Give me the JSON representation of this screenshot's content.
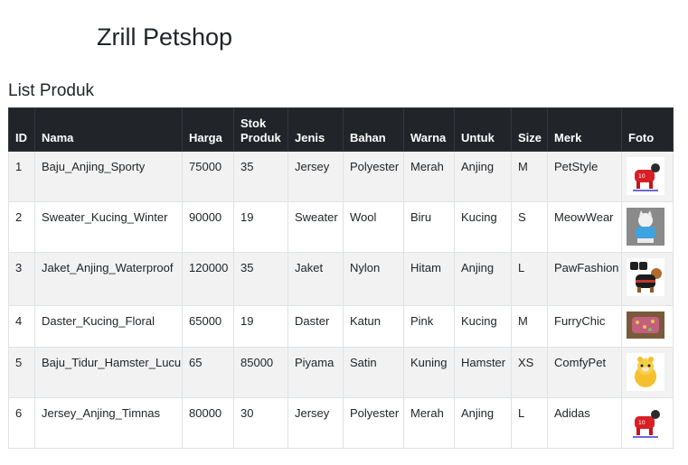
{
  "header": {
    "title": "Zrill Petshop"
  },
  "section": {
    "title": "List Produk"
  },
  "table": {
    "columns": [
      "ID",
      "Nama",
      "Harga",
      "Stok Produk",
      "Jenis",
      "Bahan",
      "Warna",
      "Untuk",
      "Size",
      "Merk",
      "Foto"
    ],
    "rows": [
      {
        "id": "1",
        "nama": "Baju_Anjing_Sporty",
        "harga": "75000",
        "stok": "35",
        "jenis": "Jersey",
        "bahan": "Polyester",
        "warna": "Merah",
        "untuk": "Anjing",
        "size": "M",
        "merk": "PetStyle",
        "foto": "red-dog-jersey-photo"
      },
      {
        "id": "2",
        "nama": "Sweater_Kucing_Winter",
        "harga": "90000",
        "stok": "19",
        "jenis": "Sweater",
        "bahan": "Wool",
        "warna": "Biru",
        "untuk": "Kucing",
        "size": "S",
        "merk": "MeowWear",
        "foto": "cat-blue-sweater-photo"
      },
      {
        "id": "3",
        "nama": "Jaket_Anjing_Waterproof",
        "harga": "120000",
        "stok": "35",
        "jenis": "Jaket",
        "bahan": "Nylon",
        "warna": "Hitam",
        "untuk": "Anjing",
        "size": "L",
        "merk": "PawFashion",
        "foto": "dog-black-jacket-photo"
      },
      {
        "id": "4",
        "nama": "Daster_Kucing_Floral",
        "harga": "65000",
        "stok": "19",
        "jenis": "Daster",
        "bahan": "Katun",
        "warna": "Pink",
        "untuk": "Kucing",
        "size": "M",
        "merk": "FurryChic",
        "foto": "floral-cat-dress-photo"
      },
      {
        "id": "5",
        "nama": "Baju_Tidur_Hamster_Lucu",
        "harga": "65",
        "stok": "85000",
        "jenis": "Piyama",
        "bahan": "Satin",
        "warna": "Kuning",
        "untuk": "Hamster",
        "size": "XS",
        "merk": "ComfyPet",
        "foto": "hamster-yellow-pajama-photo"
      },
      {
        "id": "6",
        "nama": "Jersey_Anjing_Timnas",
        "harga": "80000",
        "stok": "30",
        "jenis": "Jersey",
        "bahan": "Polyester",
        "warna": "Merah",
        "untuk": "Anjing",
        "size": "L",
        "merk": "Adidas",
        "foto": "red-dog-jersey-photo"
      }
    ]
  }
}
